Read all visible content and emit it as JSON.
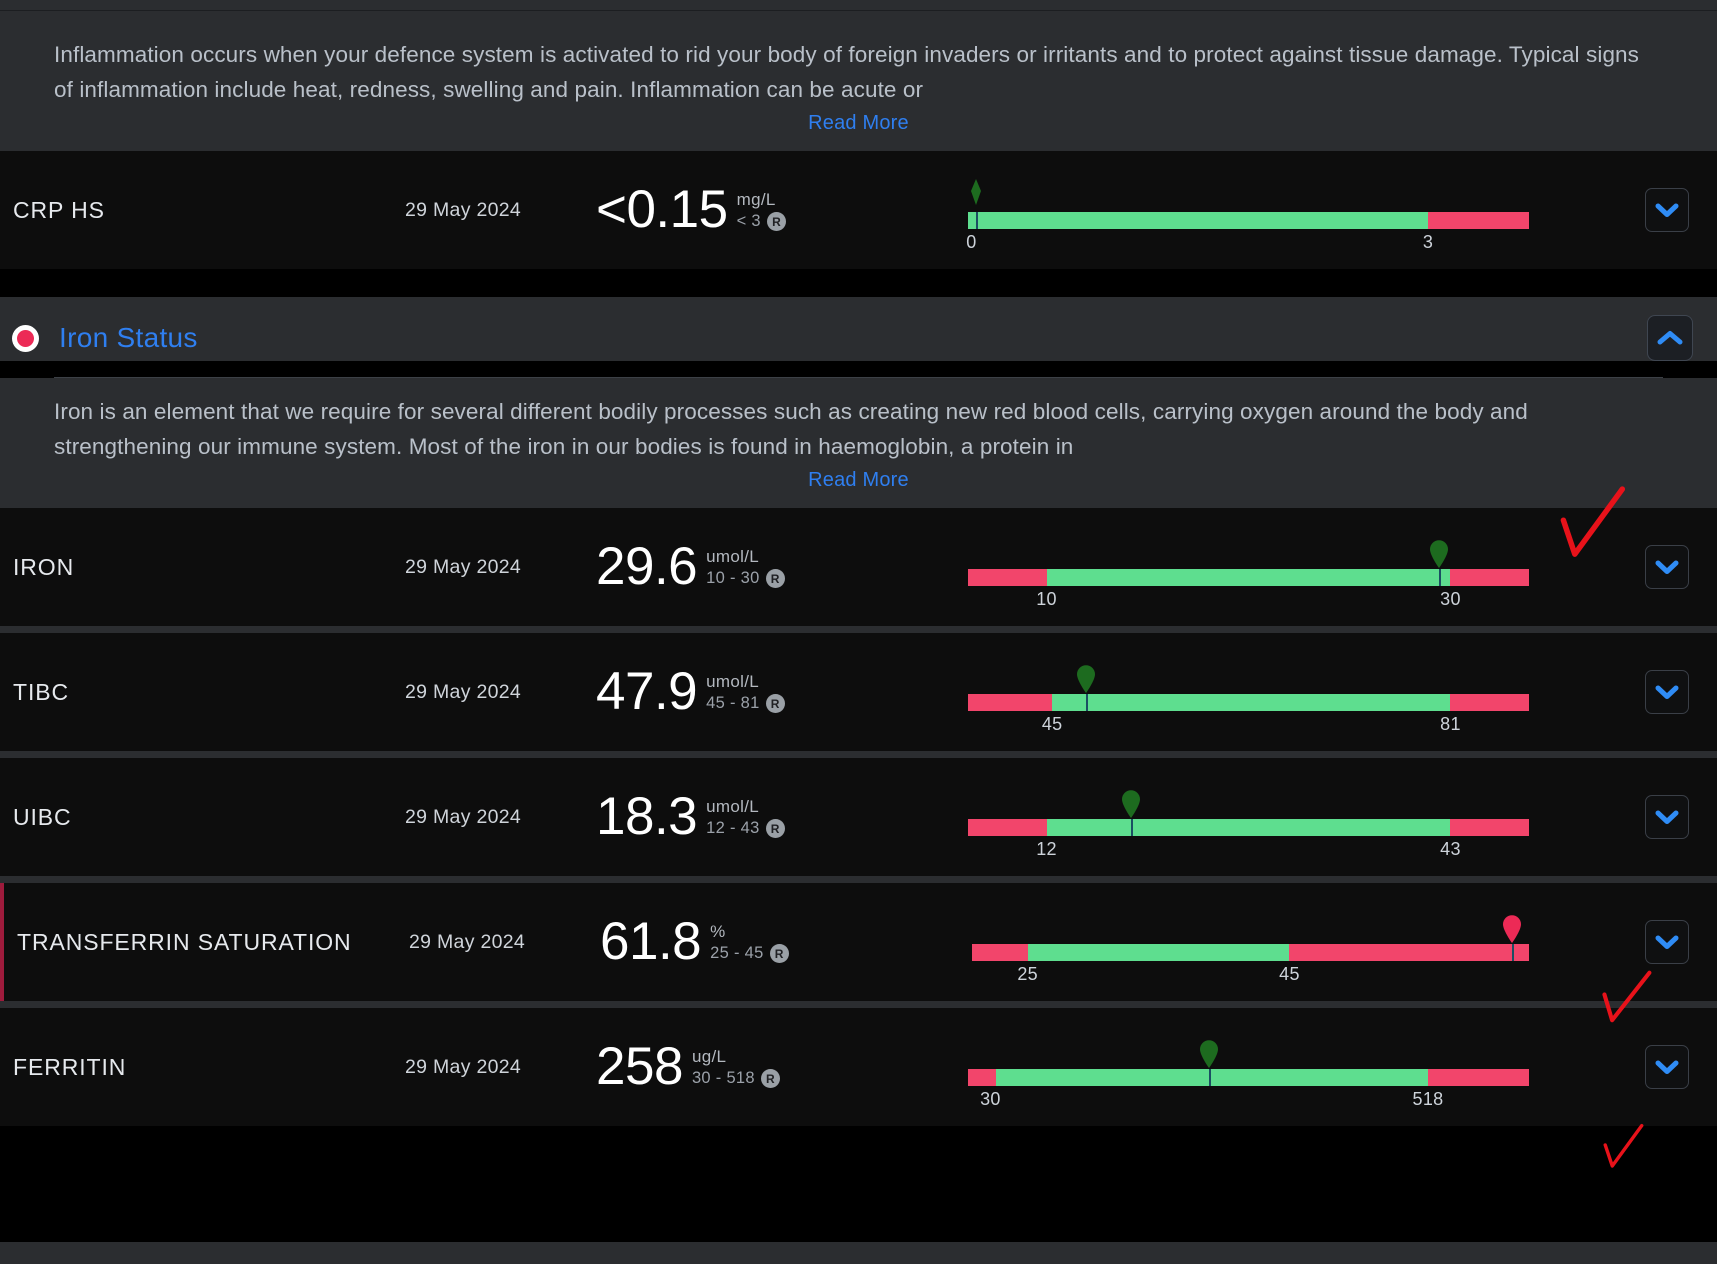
{
  "theme": {
    "accent_blue": "#2f7ff0",
    "in_range_green": "#5ede8f",
    "out_range_red": "#f2456b",
    "marker_green": "#1d6b1f",
    "marker_red": "#ec2a56",
    "panel_bg": "#2b2d30",
    "row_bg": "#0d0d0d",
    "annotation_red": "#e8121a"
  },
  "inflammation_section": {
    "description": "Inflammation occurs when your defence system is activated to rid your body of foreign invaders or irritants and to protect against tissue damage. Typical signs of inflammation include heat, redness, swelling and pain. Inflammation can be acute or",
    "read_more_label": "Read More"
  },
  "iron_section": {
    "title": "Iron Status",
    "status_dot": "red-status-dot",
    "collapse_icon": "chevron-up-icon",
    "description": "Iron is an element that we require for several different bodily processes such as creating new red blood cells, carrying oxygen around the body and strengthening our immune system. Most of the iron in our bodies is found in haemoglobin, a protein in",
    "read_more_label": "Read More"
  },
  "rows": [
    {
      "name": "CRP HS",
      "date": "29 May 2024",
      "value": "<0.15",
      "unit": "mg/L",
      "range_text": "< 3",
      "badge": "R",
      "expand_icon": "chevron-down-icon",
      "flagged": false,
      "gauge": {
        "low_pct": 0,
        "ok_pct": 82,
        "high_pct": 18,
        "marker_pct": 1.5,
        "marker_color": "green",
        "marker_shape": "diamond",
        "ticks": [
          {
            "label": "0",
            "pos_pct": 0.6
          },
          {
            "label": "3",
            "pos_pct": 82
          }
        ]
      }
    },
    {
      "name": "IRON",
      "date": "29 May 2024",
      "value": "29.6",
      "unit": "umol/L",
      "range_text": "10 - 30",
      "badge": "R",
      "expand_icon": "chevron-down-icon",
      "flagged": false,
      "annotation": "red-check-mark",
      "gauge": {
        "low_pct": 14,
        "ok_pct": 72,
        "high_pct": 14,
        "marker_pct": 84,
        "marker_color": "green",
        "marker_shape": "pin",
        "ticks": [
          {
            "label": "10",
            "pos_pct": 14
          },
          {
            "label": "30",
            "pos_pct": 86
          }
        ]
      }
    },
    {
      "name": "TIBC",
      "date": "29 May 2024",
      "value": "47.9",
      "unit": "umol/L",
      "range_text": "45 - 81",
      "badge": "R",
      "expand_icon": "chevron-down-icon",
      "flagged": false,
      "gauge": {
        "low_pct": 15,
        "ok_pct": 71,
        "high_pct": 14,
        "marker_pct": 21,
        "marker_color": "green",
        "marker_shape": "pin",
        "ticks": [
          {
            "label": "45",
            "pos_pct": 15
          },
          {
            "label": "81",
            "pos_pct": 86
          }
        ]
      }
    },
    {
      "name": "UIBC",
      "date": "29 May 2024",
      "value": "18.3",
      "unit": "umol/L",
      "range_text": "12 - 43",
      "badge": "R",
      "expand_icon": "chevron-down-icon",
      "flagged": false,
      "gauge": {
        "low_pct": 14,
        "ok_pct": 72,
        "high_pct": 14,
        "marker_pct": 29,
        "marker_color": "green",
        "marker_shape": "pin",
        "ticks": [
          {
            "label": "12",
            "pos_pct": 14
          },
          {
            "label": "43",
            "pos_pct": 86
          }
        ]
      }
    },
    {
      "name": "TRANSFERRIN SATURATION",
      "date": "29 May 2024",
      "value": "61.8",
      "unit": "%",
      "range_text": "25 - 45",
      "badge": "R",
      "expand_icon": "chevron-down-icon",
      "flagged": true,
      "annotation": "red-check-mark",
      "gauge": {
        "low_pct": 10,
        "ok_pct": 47,
        "high_pct": 43,
        "marker_pct": 97,
        "marker_color": "red",
        "marker_shape": "pin",
        "ticks": [
          {
            "label": "25",
            "pos_pct": 10
          },
          {
            "label": "45",
            "pos_pct": 57
          }
        ]
      }
    },
    {
      "name": "FERRITIN",
      "date": "29 May 2024",
      "value": "258",
      "unit": "ug/L",
      "range_text": "30 - 518",
      "badge": "R",
      "expand_icon": "chevron-down-icon",
      "flagged": false,
      "annotation": "red-check-mark",
      "gauge": {
        "low_pct": 5,
        "ok_pct": 77,
        "high_pct": 18,
        "marker_pct": 43,
        "marker_color": "green",
        "marker_shape": "pin",
        "ticks": [
          {
            "label": "30",
            "pos_pct": 4
          },
          {
            "label": "518",
            "pos_pct": 82
          }
        ]
      }
    }
  ]
}
